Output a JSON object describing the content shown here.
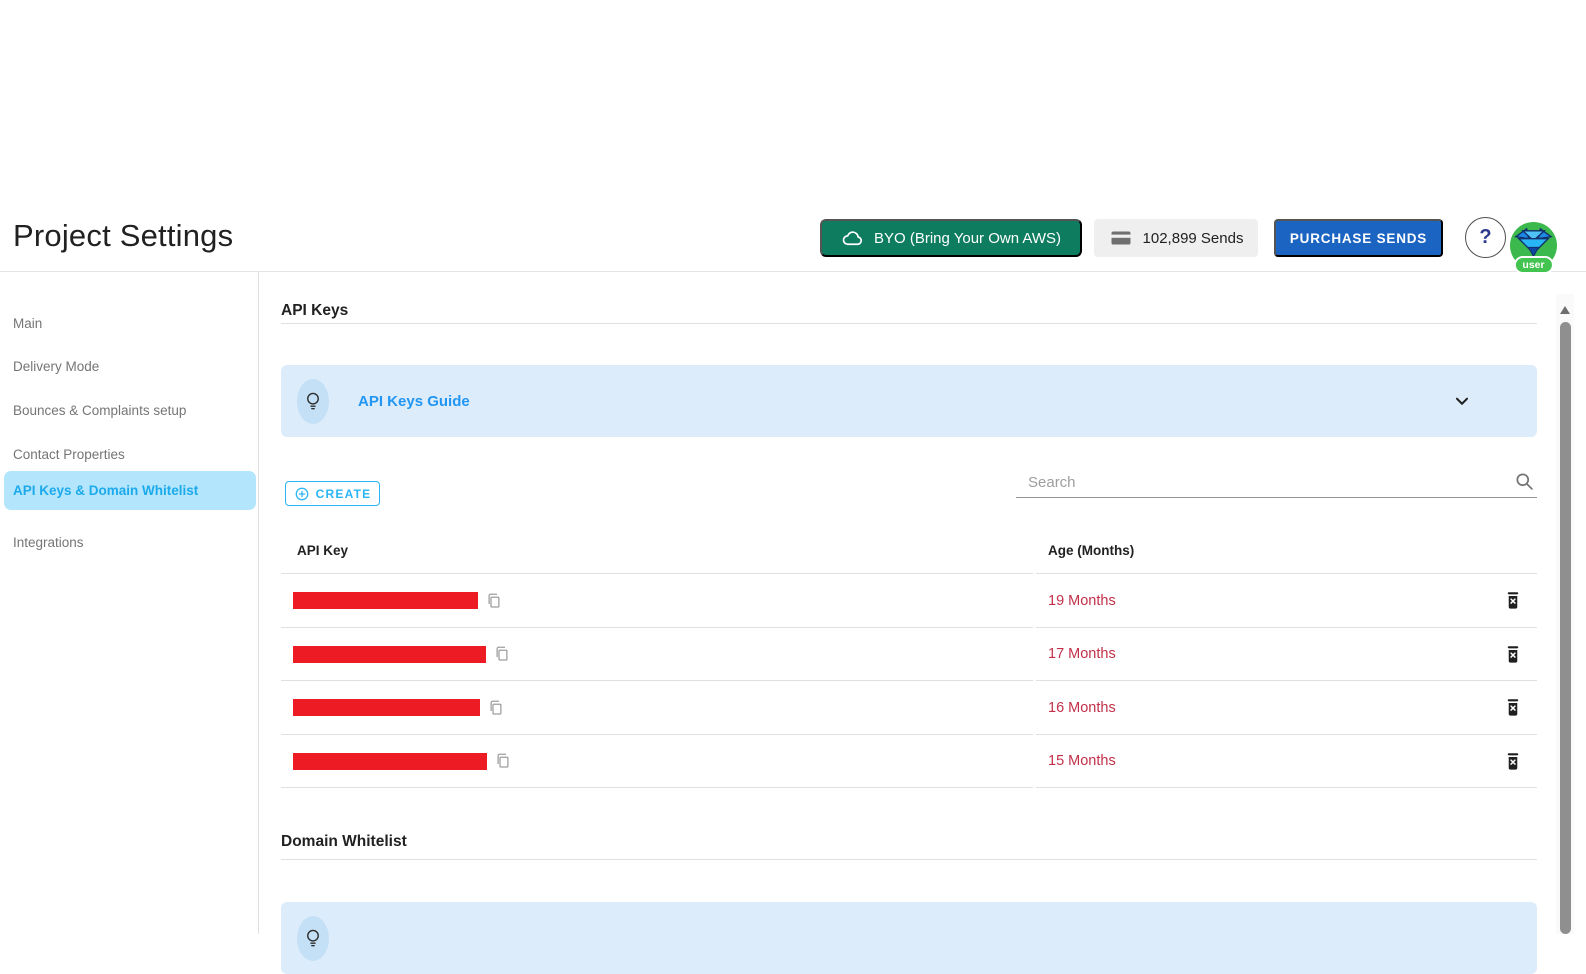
{
  "page": {
    "title": "Project Settings"
  },
  "header": {
    "byo_button": "BYO (Bring Your Own AWS)",
    "sends_counter": "102,899 Sends",
    "purchase_button": "PURCHASE SENDS",
    "help_label": "?",
    "avatar_badge": "user"
  },
  "sidebar": {
    "items": [
      {
        "label": "Main",
        "selected": false
      },
      {
        "label": "Delivery Mode",
        "selected": false
      },
      {
        "label": "Bounces & Complaints setup",
        "selected": false
      },
      {
        "label": "Contact Properties",
        "selected": false
      },
      {
        "label": "API Keys & Domain Whitelist",
        "selected": true
      },
      {
        "label": "Integrations",
        "selected": false
      }
    ]
  },
  "api_keys": {
    "section_title": "API Keys",
    "guide_title": "API Keys Guide",
    "create_button": "CREATE",
    "search_placeholder": "Search",
    "table": {
      "columns": [
        "API Key",
        "Age (Months)"
      ],
      "rows": [
        {
          "key_redacted": true,
          "key_bar_width": 185,
          "age": "19 Months"
        },
        {
          "key_redacted": true,
          "key_bar_width": 193,
          "age": "17 Months"
        },
        {
          "key_redacted": true,
          "key_bar_width": 187,
          "age": "16 Months"
        },
        {
          "key_redacted": true,
          "key_bar_width": 194,
          "age": "15 Months"
        }
      ]
    }
  },
  "domain_whitelist": {
    "section_title": "Domain Whitelist",
    "guide_title_partial": ""
  },
  "colors": {
    "byo_green": "#0d7c5f",
    "purchase_blue": "#1b64c2",
    "accent_blue": "#2ab5f5",
    "selected_item_bg": "#b3e5fc",
    "guide_panel_bg": "#ddecfa",
    "guide_title_blue": "#2196f3",
    "redaction_red": "#ed1c24",
    "age_red": "#c23049",
    "avatar_green": "#3cb94d"
  }
}
